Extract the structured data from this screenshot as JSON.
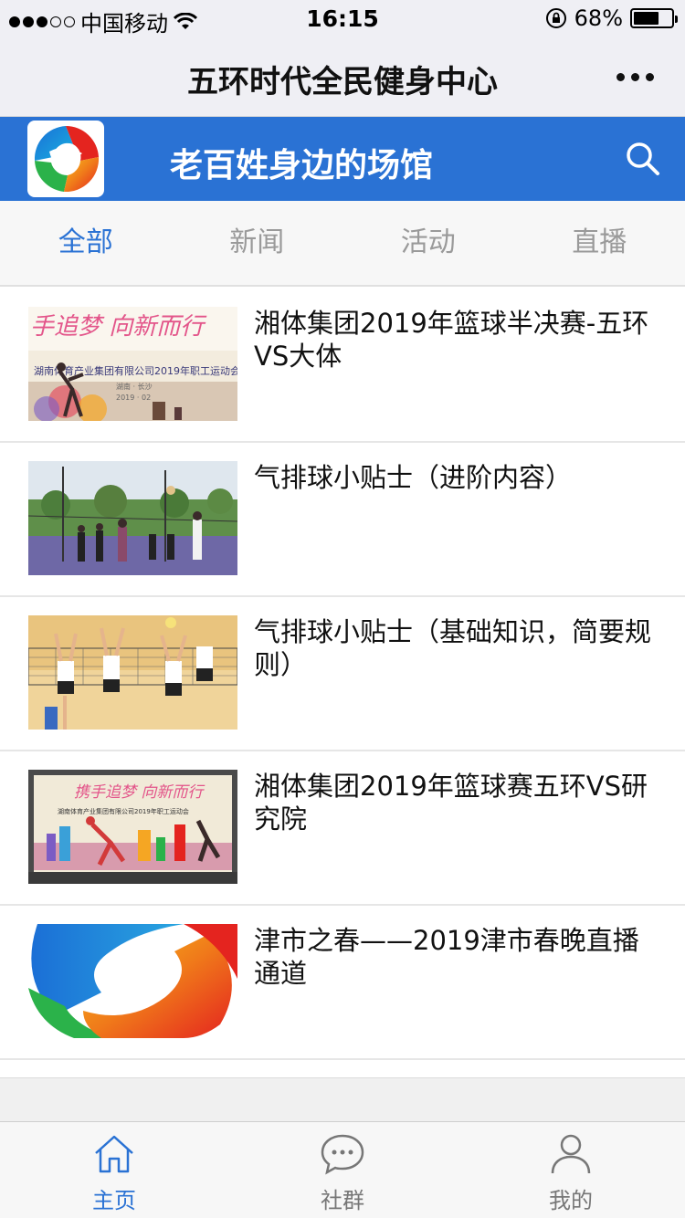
{
  "status_bar": {
    "carrier": "中国移动",
    "time": "16:15",
    "battery_percent": "68%",
    "battery_level": 0.68,
    "signal_bars_filled": 3,
    "icons": [
      "signal-icon",
      "wifi-icon",
      "rotation-lock-icon",
      "battery-icon"
    ]
  },
  "nav": {
    "title": "五环时代全民健身中心",
    "more_icon": "more-dots-icon"
  },
  "banner": {
    "title": "老百姓身边的场馆",
    "logo_icon": "wuhuan-logo-icon",
    "search_icon": "search-icon",
    "color": "#2a72d4"
  },
  "tabs": [
    {
      "label": "全部",
      "active": true
    },
    {
      "label": "新闻",
      "active": false
    },
    {
      "label": "活动",
      "active": false
    },
    {
      "label": "直播",
      "active": false
    }
  ],
  "articles": [
    {
      "title": "湘体集团2019年篮球半决赛-五环VS大体",
      "thumb": "event-banner-photo"
    },
    {
      "title": "气排球小贴士（进阶内容）",
      "thumb": "outdoor-volleyball-photo"
    },
    {
      "title": "气排球小贴士（基础知识，简要规则）",
      "thumb": "indoor-volleyball-photo"
    },
    {
      "title": "湘体集团2019年篮球赛五环VS研究院",
      "thumb": "stage-backdrop-photo"
    },
    {
      "title": "津市之春——2019津市春晚直播通道",
      "thumb": "logo-thumbnail"
    }
  ],
  "tabbar": [
    {
      "label": "主页",
      "icon": "home-icon",
      "active": true
    },
    {
      "label": "社群",
      "icon": "chat-bubble-icon",
      "active": false
    },
    {
      "label": "我的",
      "icon": "user-icon",
      "active": false
    }
  ],
  "colors": {
    "accent": "#2a72d4",
    "inactive_text": "#9a9a9a"
  }
}
